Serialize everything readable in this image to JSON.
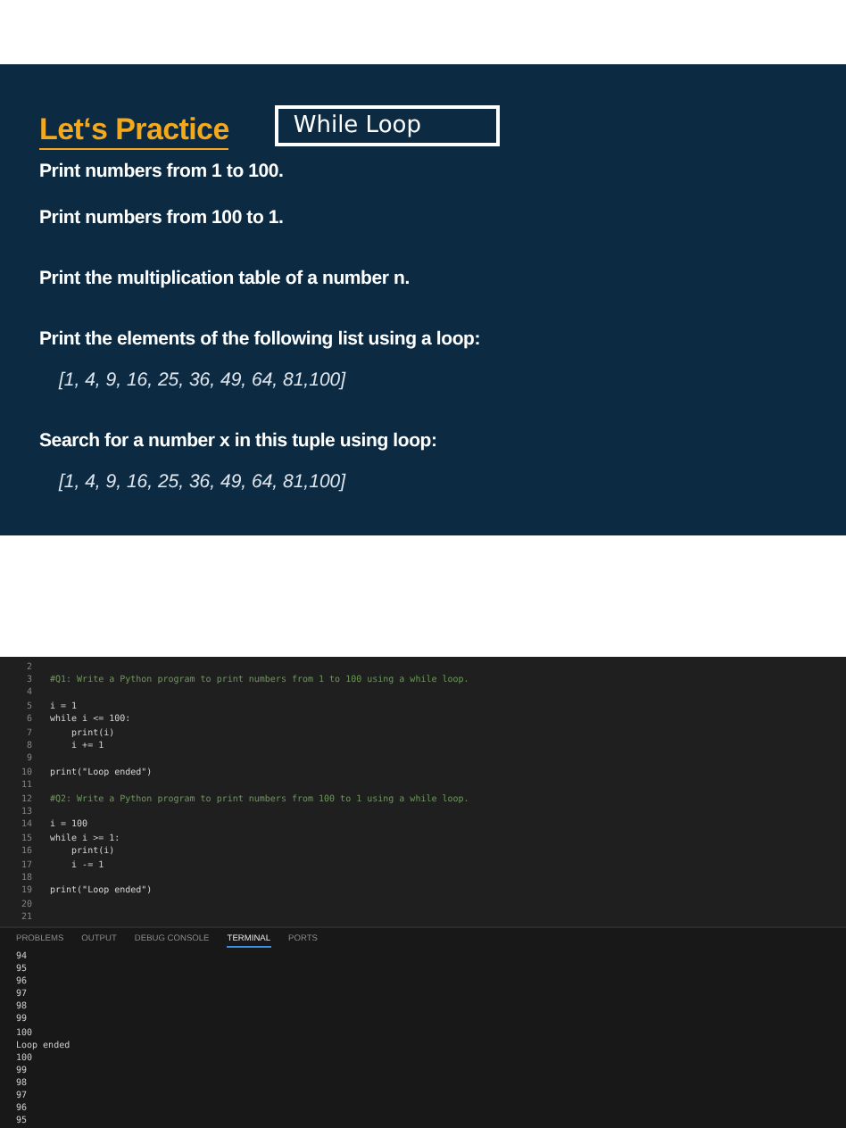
{
  "slide": {
    "title": "Let‘s Practice",
    "annotation": "While Loop",
    "tasks": [
      {
        "text": "Print numbers from 1 to 100."
      },
      {
        "text": "Print numbers from 100 to 1."
      },
      {
        "text": "Print the multiplication table of a number n."
      },
      {
        "text": "Print the elements of the following list using a loop:",
        "detail": "[1, 4, 9, 16, 25, 36, 49, 64, 81,100]"
      },
      {
        "text": "Search for a number x in this tuple using loop:",
        "detail": "[1, 4, 9, 16, 25, 36, 49, 64, 81,100]"
      }
    ]
  },
  "editor": {
    "lines": [
      {
        "number": "2"
      },
      {
        "number": "3",
        "kind": "comment",
        "code": "#Q1: Write a Python program to print numbers from 1 to 100 using a while loop."
      },
      {
        "number": "4"
      },
      {
        "number": "5",
        "kind": "code",
        "code": "i = 1"
      },
      {
        "number": "6",
        "kind": "code",
        "code": "while i <= 100:"
      },
      {
        "number": "7",
        "kind": "code",
        "code": "    print(i)"
      },
      {
        "number": "8",
        "kind": "code",
        "code": "    i += 1"
      },
      {
        "number": "9"
      },
      {
        "number": "10",
        "kind": "code",
        "code": "print(\"Loop ended\")"
      },
      {
        "number": "11"
      },
      {
        "number": "12",
        "kind": "comment",
        "code": "#Q2: Write a Python program to print numbers from 100 to 1 using a while loop."
      },
      {
        "number": "13"
      },
      {
        "number": "14",
        "kind": "code",
        "code": "i = 100"
      },
      {
        "number": "15",
        "kind": "code",
        "code": "while i >= 1:"
      },
      {
        "number": "16",
        "kind": "code",
        "code": "    print(i)"
      },
      {
        "number": "17",
        "kind": "code",
        "code": "    i -= 1"
      },
      {
        "number": "18"
      },
      {
        "number": "19",
        "kind": "code",
        "code": "print(\"Loop ended\")"
      },
      {
        "number": "20"
      },
      {
        "number": "21"
      }
    ]
  },
  "panel": {
    "tabs": [
      {
        "label": "PROBLEMS",
        "selected": false
      },
      {
        "label": "OUTPUT",
        "selected": false
      },
      {
        "label": "DEBUG CONSOLE",
        "selected": false
      },
      {
        "label": "TERMINAL",
        "selected": true
      },
      {
        "label": "PORTS",
        "selected": false
      }
    ],
    "terminal_lines": [
      "94",
      "95",
      "96",
      "97",
      "98",
      "99",
      "100",
      "Loop ended",
      "100",
      "99",
      "98",
      "97",
      "96",
      "95"
    ]
  }
}
